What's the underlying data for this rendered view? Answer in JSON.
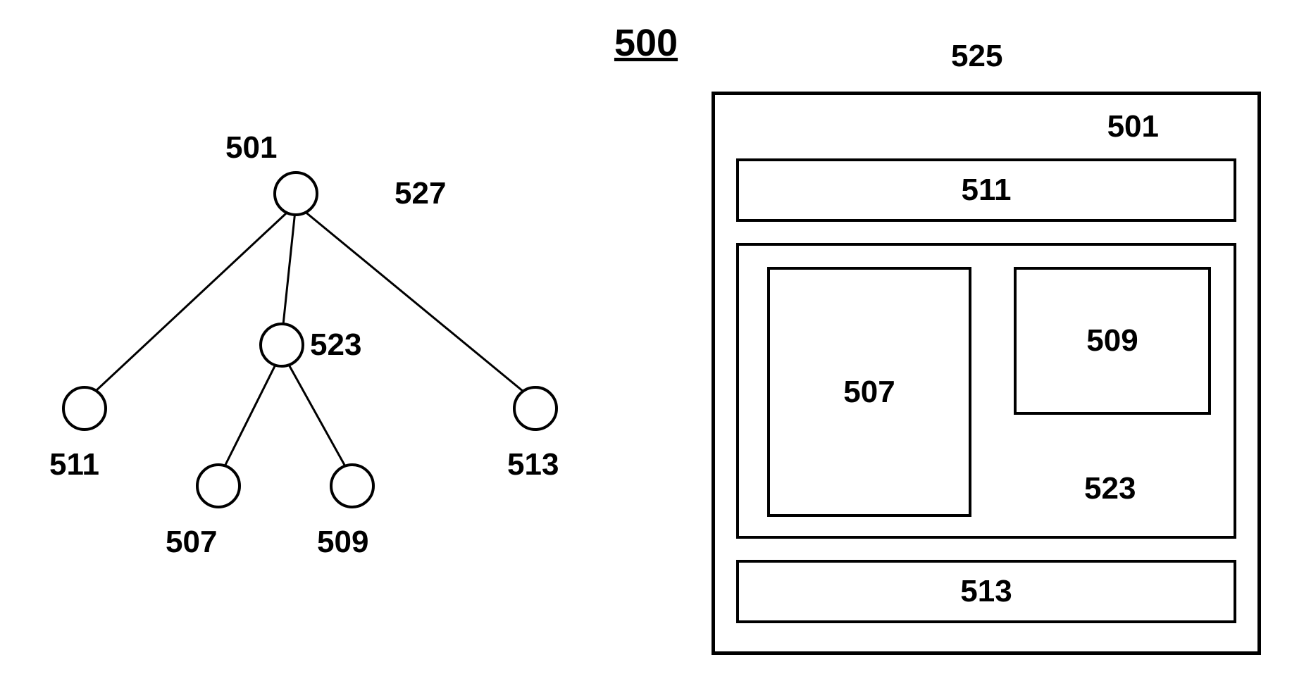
{
  "title": "500",
  "tree": {
    "root_label": "501",
    "middle_label": "523",
    "outer_label": "527",
    "leaves": {
      "left": "511",
      "right": "513",
      "mid_left": "507",
      "mid_right": "509"
    }
  },
  "layout": {
    "outer_label": "525",
    "container_label": "501",
    "top_box": "511",
    "middle_group_label": "523",
    "middle_left": "507",
    "middle_right": "509",
    "bottom_box": "513"
  }
}
